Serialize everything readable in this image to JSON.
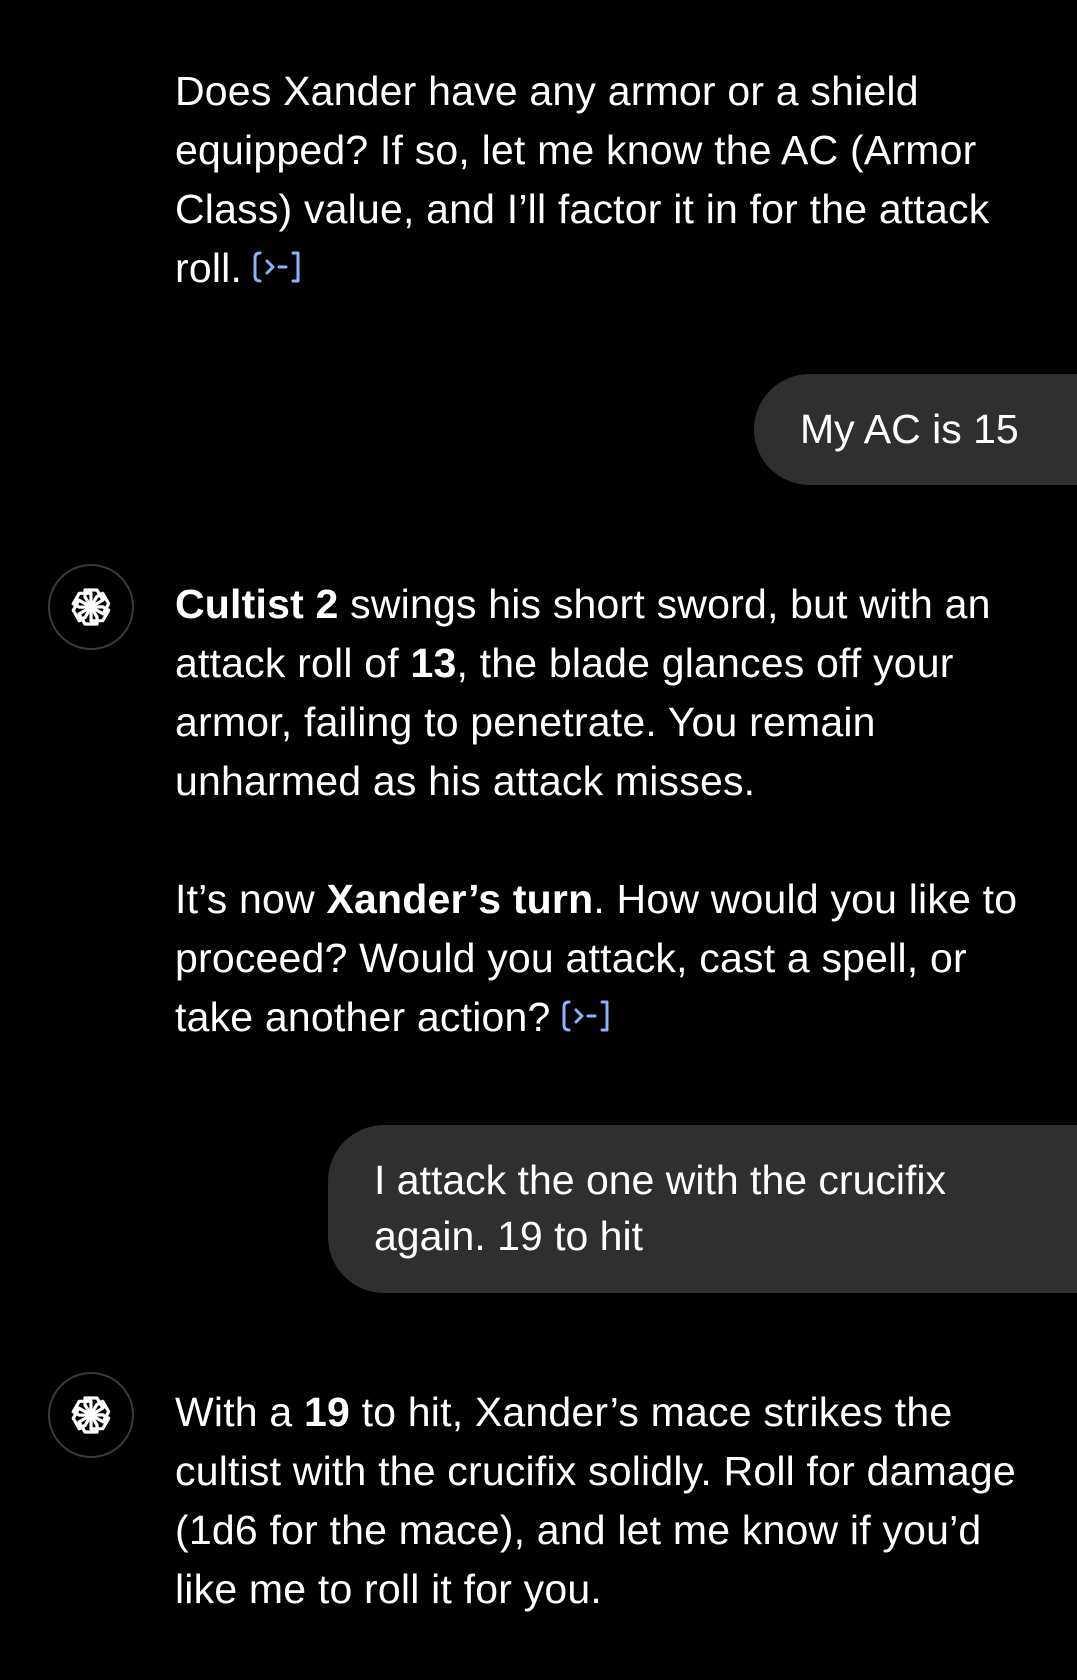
{
  "messages": {
    "m1": {
      "line": "Does Xander have any armor or a shield equipped? If so, let me know the AC (Armor Class) value, and I’ll factor it in for the attack roll."
    },
    "u1": {
      "text": "My AC is 15"
    },
    "m2": {
      "p1_bold1": "Cultist 2",
      "p1_t1": " swings his short sword, but with an attack roll of ",
      "p1_bold2": "13",
      "p1_t2": ", the blade glances off your armor, failing to penetrate. You remain unharmed as his attack misses.",
      "p2_t1": "It’s now ",
      "p2_bold": "Xander’s turn",
      "p2_t2": ". How would you like to proceed? Would you attack, cast a spell, or take another action?"
    },
    "u2": {
      "text": "I attack the one with the crucifix again. 19 to hit"
    },
    "m3": {
      "t1": "With a ",
      "bold": "19",
      "t2": " to hit, Xander’s mace strikes the cultist with the crucifix solidly. Roll for damage (1d6 for the mace), and let me know if you’d like me to roll it for you."
    }
  },
  "icons": {
    "assistant_avatar": "openai-logo-icon",
    "code_ref": "code-interpreter-icon"
  },
  "colors": {
    "background": "#000000",
    "user_bubble": "#2f2f2f",
    "text": "#ffffff",
    "code_icon": "#8ab4f8"
  }
}
